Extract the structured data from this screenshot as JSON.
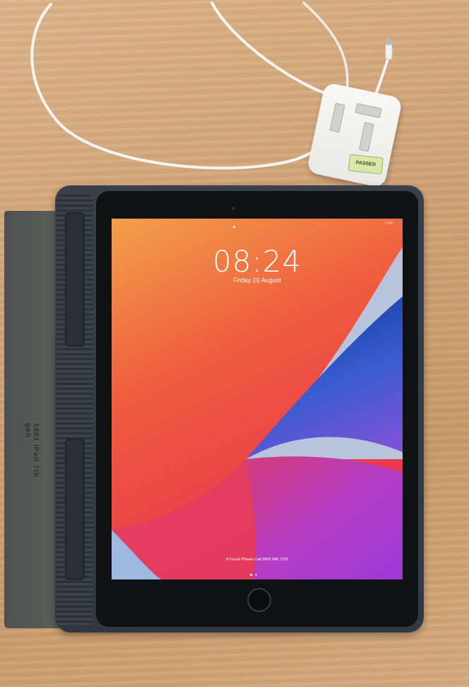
{
  "photo": {
    "subject": "",
    "colors": {
      "desk": "#cfa277",
      "case": "#363c44",
      "folio_cover": "#545755",
      "charger": "#f2f2f0",
      "cable": "#f4f4f2",
      "wallpaper_orange": "#f09040",
      "wallpaper_red": "#e8384a",
      "wallpaper_blue": "#1e4ea8",
      "wallpaper_magenta": "#b03cc8"
    }
  },
  "cover": {
    "brand_text": "1881 iPad 7th gen"
  },
  "charger": {
    "sticker_text": "PASSED"
  },
  "lock_screen": {
    "time": "08:24",
    "date": "Friday 26 August",
    "battery": "77%",
    "lock_message": "If Found Please Call 0800 088 7232"
  },
  "icons": [
    "camera-icon",
    "home-button",
    "page-dot"
  ]
}
